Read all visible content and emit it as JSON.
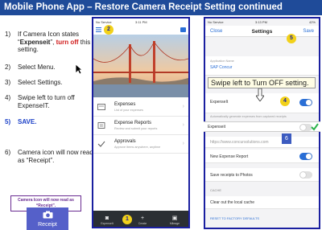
{
  "slide": {
    "title": "Mobile Phone App – Restore Camera Receipt Setting continued"
  },
  "steps": [
    {
      "num": "1)",
      "pre": "If Camera Icon states “",
      "bold": "Expenseit",
      "mid": "”, ",
      "red": "turn off",
      "post": " this setting."
    },
    {
      "num": "2)",
      "text": "Select Menu."
    },
    {
      "num": "3)",
      "text": "Select Settings."
    },
    {
      "num": "4)",
      "text": "Swipe left to turn off ExpenseIT."
    },
    {
      "num": "5)",
      "text": "SAVE."
    },
    {
      "num": "6)",
      "text": "Camera icon will now read as “Receipt”."
    }
  ],
  "callout": {
    "line1": "Camera Icon will now read as",
    "line2": "“Receipt”."
  },
  "camera_tile": {
    "label": "Receipt"
  },
  "phone1": {
    "status_left": "No Service",
    "status_time": "3:11 PM",
    "menu": [
      {
        "title": "Expenses",
        "sub": "List of your expenses"
      },
      {
        "title": "Expense Reports",
        "sub": "Review and submit your reports"
      },
      {
        "title": "Approvals",
        "sub": "Approve items anywhere, anytime"
      }
    ],
    "tabs": [
      "ExpenseIt",
      "Create",
      "Mileage"
    ],
    "badge1": "1",
    "badge2": "2"
  },
  "phone2": {
    "status_left": "No Service",
    "status_time": "3:13 PM",
    "status_right": "42%",
    "nav": {
      "close": "Close",
      "title": "Settings",
      "save": "Save"
    },
    "app_name_label": "Application Name",
    "app_name_value": "SAP Concur",
    "expenseit_label": "ExpenseIt",
    "expenseit_desc": "Automatically generate expenses from captured receipts",
    "expenseit_bar_label": "Expenseit",
    "url": "https://www.concursolutions.com",
    "new_report": "New Expense Report",
    "save_photos": "Save receipts to Photos",
    "cache_header": "CACHE",
    "clear_cache": "Clear out the local cache",
    "reset": "RESET TO FACTORY DEFAULTS",
    "badge4": "4",
    "badge5": "5",
    "badge6": "6"
  },
  "swipe_note": "Swipe left to Turn OFF setting.",
  "colors": {
    "title_bg": "#1f4b99",
    "accent": "#2a6fd6",
    "badge": "#f2d11a",
    "frame": "#1a1fa0",
    "toggle_on": "#2a6fd6"
  }
}
